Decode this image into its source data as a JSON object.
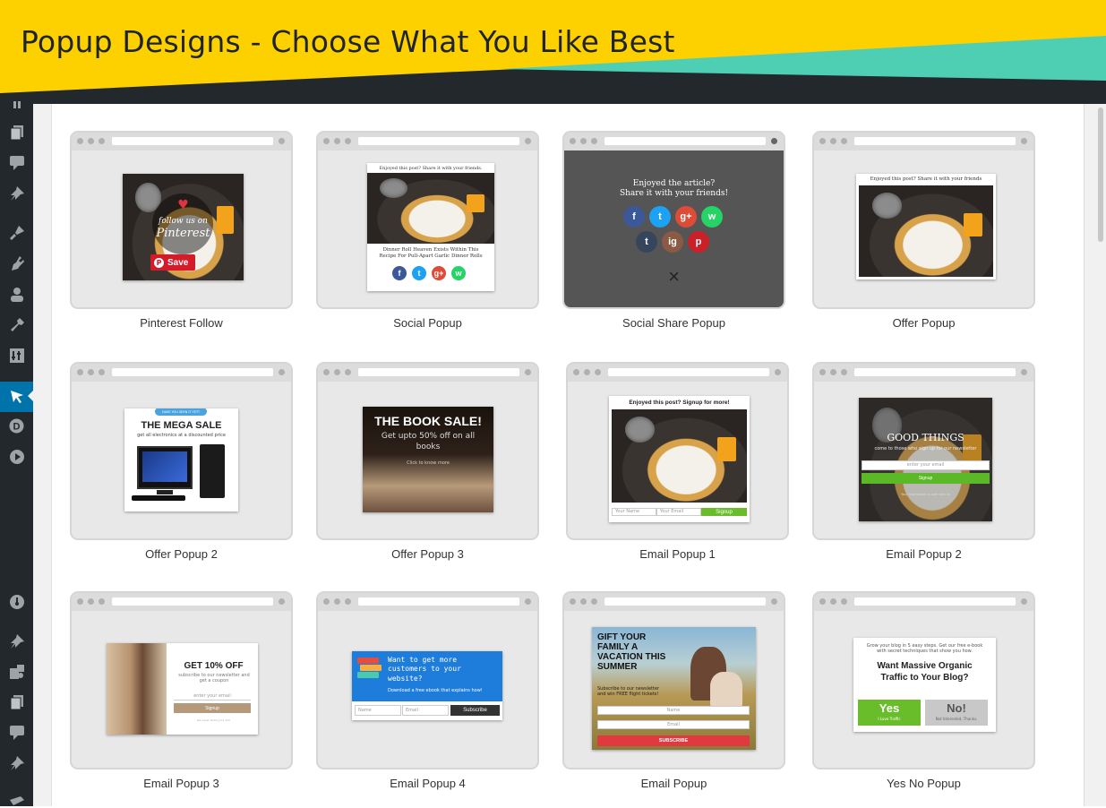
{
  "banner": {
    "title": "Popup Designs - Choose What You Like Best",
    "colors": {
      "yellow": "#fdd100",
      "teal": "#4ecfb4",
      "dark": "#23282d"
    }
  },
  "sidebar": {
    "icons": [
      "posts-icon",
      "pages-icon",
      "comments-icon",
      "pin-icon",
      "appearance-icon",
      "plugins-icon",
      "users-icon",
      "tools-icon",
      "settings-icon",
      "cursor-icon",
      "d-icon",
      "play-icon",
      "gauge-icon",
      "pin-icon",
      "puzzle-icon",
      "pages-icon",
      "comments-icon",
      "pin-icon"
    ],
    "active_color": "#0073aa"
  },
  "cards": [
    {
      "name": "Pinterest Follow",
      "pin": {
        "line1": "follow us on",
        "line2": "Pinterest",
        "save": "Save"
      }
    },
    {
      "name": "Social Popup",
      "header": "Enjoyed this post? Share it with your friends.",
      "caption": "Dinner Roll Heaven Exists Within This Recipe For Pull-Apart Garlic Dinner Rolls"
    },
    {
      "name": "Social Share Popup",
      "line1": "Enjoyed the article?",
      "line2": "Share it with your friends!",
      "close": "×"
    },
    {
      "name": "Offer Popup",
      "header": "Enjoyed this post? Share it with your friends"
    },
    {
      "name": "Offer Popup 2",
      "ribbon": "HAVE YOU SEEN IT YET?",
      "title": "THE MEGA SALE",
      "sub": "get all electronics at a discounted price"
    },
    {
      "name": "Offer Popup 3",
      "title": "THE BOOK SALE!",
      "sub": "Get upto 50% off on all books",
      "cta": "Click to know more"
    },
    {
      "name": "Email Popup 1",
      "header": "Enjoyed this post? Signup for more!",
      "name_ph": "Your Name",
      "email_ph": "Your Email",
      "btn": "Signup"
    },
    {
      "name": "Email Popup 2",
      "title": "GOOD THINGS",
      "sub": "come to those who sign up for our newsletter",
      "email_ph": "enter your email",
      "btn": "Signup",
      "foot": "Your information is safe with us"
    },
    {
      "name": "Email Popup 3",
      "title": "GET 10% OFF",
      "sub": "subscribe to our newsletter and get a coupon",
      "email_ph": "enter your email",
      "btn": "Signup",
      "foot": "we never share your info"
    },
    {
      "name": "Email Popup 4",
      "title": "Want to get more customers to your website?",
      "sub": "Download a free ebook that explains how!",
      "name_ph": "Name",
      "email_ph": "Email",
      "btn": "Subscribe"
    },
    {
      "name": "Email Popup",
      "title": "GIFT YOUR FAMILY A VACATION THIS SUMMER",
      "sub": "Subscribe to our newsletter and win FREE flight tickets!",
      "name_ph": "Name",
      "email_ph": "Email",
      "btn": "SUBSCRIBE"
    },
    {
      "name": "Yes No Popup",
      "intro": "Grow your blog in 5 easy steps. Get our free e-book with secret techniques that show you how.",
      "title": "Want Massive Organic Traffic to Your Blog?",
      "yes": "Yes",
      "yes_sub": "I Love Traffic",
      "no": "No!",
      "no_sub": "Not Interested, Thanks."
    }
  ]
}
